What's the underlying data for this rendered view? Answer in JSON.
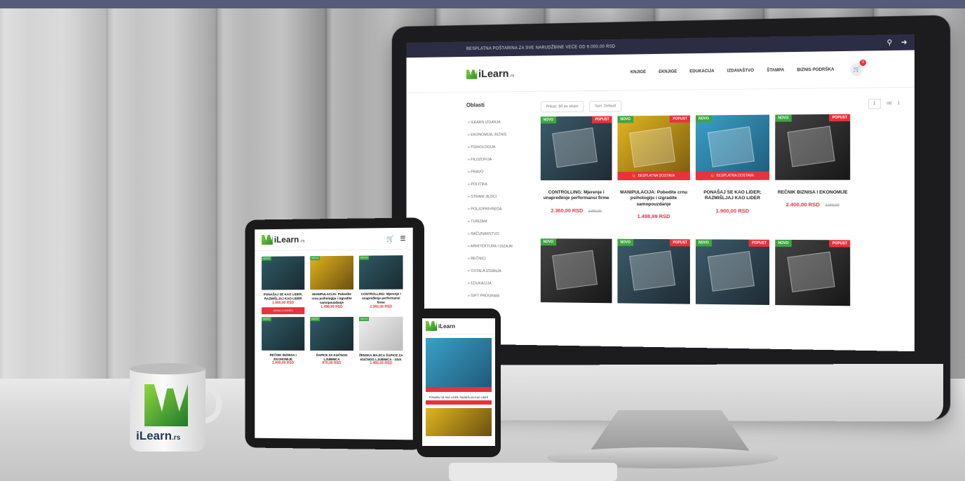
{
  "brand": {
    "name": "iLearn",
    "suffix": ".rs"
  },
  "colors": {
    "accent_red": "#e8323c",
    "accent_green": "#3da542",
    "topbar": "#2c2d44"
  },
  "desktop": {
    "topbar_text": "BESPLATNA POŠTARINA ZA SVE NARUDŽBINE VEĆE OD 6.000,00 RSD",
    "nav": [
      "KNJIGE",
      "EKNJIGE",
      "EDUKACIJA",
      "IZDAVAŠTVO",
      "ŠTAMPA",
      "BIZNIS PODRŠKA"
    ],
    "cart_count": "0",
    "sidebar_title": "Oblasti",
    "categories": [
      "» ILEARN IZDANJA",
      "» EKONOMIJA, BIZNIS",
      "» PSIHOLOGIJA",
      "» FILOZOFIJA",
      "» PRAVO",
      "» POLITIKA",
      "» STRANI JEZICI",
      "» POLJOPRIVREDA",
      "» TURIZAM",
      "» RAČUNARSTVO",
      "» ARHITEKTURA I DIZAJN",
      "» REČNICI",
      "» OSTALA IZDANJA",
      "» EDUKACIJA",
      "» GIFT PROGRAM"
    ],
    "per_page": "Prikaz: 80 po strani",
    "sort": "Sort: Default",
    "pager": {
      "current": "1",
      "of": "od",
      "total": "1"
    },
    "badges": {
      "novo": "NOVO",
      "popust": "POPUST",
      "free_ship": "BESPLATNA DOSTAVA"
    },
    "products": [
      {
        "title": "CONTROLLING: Mjerenje i unapređenje performansi firme",
        "price": "2.360,00 RSD",
        "old_price": "2.950,00"
      },
      {
        "title": "MANIPULACIJA: Pobedite crnu psihologiju i izgradite samopouzdanje",
        "price": "1.498,99 RSD",
        "old_price": ""
      },
      {
        "title": "PONAŠAJ SE KAO LIDER; RAZMIŠLJAJ KAO LIDER",
        "price": "1.900,00 RSD",
        "old_price": ""
      },
      {
        "title": "REČNIK BIZNISA I EKONOMIJE",
        "price": "2.400,00 RSD",
        "old_price": "3.000,00"
      }
    ]
  },
  "tablet": {
    "cart_count": "0",
    "products": [
      {
        "title": "PONAŠAJ SE KAO LIDER; RAZMIŠLJAJ KAO LIDER",
        "price": "1.900,00 RSD"
      },
      {
        "title": "MANIPULACIJA: Pobedite crnu psihologiju i izgradite samopouzdanje",
        "price": "1.498,99 RSD"
      },
      {
        "title": "CONTROLLING: Mjerenje i unapređenje performansi firme",
        "price": "2.360,00 RSD"
      },
      {
        "title": "REČNIK BIZNISA I EKONOMIJE",
        "price": "2.400,00 RSD"
      },
      {
        "title": "ŠAPICE ZA KUĆNOG LJUBIMCA",
        "price": "970,00 RSD"
      },
      {
        "title": "ŽENSKA MAJICA ŠAPICE ZA KUĆNOG LJUBIMCA - SIVA",
        "price": "1.450,00 RSD"
      }
    ],
    "button_label": "DODAJ U KORPU"
  },
  "phone": {
    "text": "PONAŠAJ SE KAO LIDER; RAZMIŠLJAJ KAO LIDER"
  },
  "mug": {
    "text": "iLearn",
    "suffix": ".rs"
  }
}
